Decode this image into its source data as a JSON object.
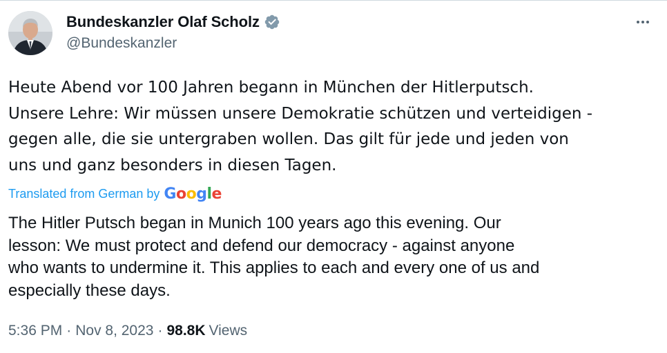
{
  "author": {
    "display_name": "Bundeskanzler Olaf Scholz",
    "handle": "@Bundeskanzler",
    "verified_icon": "verified-badge-icon",
    "avatar_icon": "avatar-portrait",
    "verified_color": "#829aab"
  },
  "more_icon": "more-horizontal-icon",
  "tweet": {
    "original_lines": [
      "Heute Abend vor 100 Jahren begann in München der Hitlerputsch.",
      "Unsere Lehre: Wir müssen unsere Demokratie schützen und verteidigen -",
      "gegen alle, die sie untergraben wollen. Das gilt für jede und jeden von",
      "uns und ganz besonders in diesen Tagen."
    ],
    "translated_label": "Translated from German by",
    "translator_brand": "Google",
    "translation_lines": [
      "The Hitler Putsch began in Munich 100 years ago this evening. Our",
      "lesson: We must protect and defend our democracy - against anyone",
      "who wants to undermine it. This applies to each and every one of us and",
      "especially these days."
    ]
  },
  "meta": {
    "time": "5:36 PM",
    "separator": "·",
    "date": "Nov 8, 2023",
    "views_count": "98.8K",
    "views_label": "Views"
  },
  "colors": {
    "link_blue": "#1d9bf0",
    "secondary_text": "#536471",
    "primary_text": "#0f1419",
    "google_blue": "#4285f4",
    "google_red": "#ea4335",
    "google_yellow": "#fbbc05",
    "google_green": "#34a853"
  }
}
